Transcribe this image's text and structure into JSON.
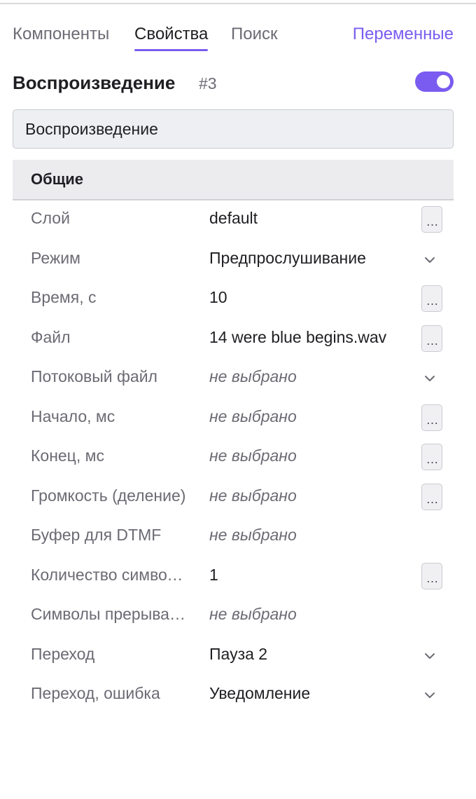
{
  "tabs": {
    "components": "Компоненты",
    "properties": "Свойства",
    "search": "Поиск",
    "variables": "Переменные"
  },
  "header": {
    "title": "Воспроизведение",
    "id": "#3",
    "enabled": true
  },
  "name_field": {
    "value": "Воспроизведение"
  },
  "section": {
    "title": "Общие"
  },
  "more_glyph": "…",
  "rows": [
    {
      "label": "Слой",
      "value": "default",
      "control": "more"
    },
    {
      "label": "Режим",
      "value": "Предпрослушивание",
      "control": "dropdown"
    },
    {
      "label": "Время, с",
      "value": "10",
      "control": "more"
    },
    {
      "label": "Файл",
      "value": "14 were blue begins.wav",
      "control": "more"
    },
    {
      "label": "Потоковый файл",
      "value": "не выбрано",
      "control": "dropdown",
      "empty": true
    },
    {
      "label": "Начало, мс",
      "value": "не выбрано",
      "control": "more",
      "empty": true
    },
    {
      "label": "Конец, мс",
      "value": "не выбрано",
      "control": "more",
      "empty": true
    },
    {
      "label": "Громкость (деление)",
      "value": "не выбрано",
      "control": "more",
      "empty": true
    },
    {
      "label": "Буфер для DTMF",
      "value": "не выбрано",
      "control": "none",
      "empty": true
    },
    {
      "label": "Количество символов",
      "value": "1",
      "control": "more"
    },
    {
      "label": "Символы прерывания",
      "value": "не выбрано",
      "control": "none",
      "empty": true
    },
    {
      "label": "Переход",
      "value": "Пауза 2",
      "control": "dropdown"
    },
    {
      "label": "Переход, ошибка",
      "value": "Уведомление",
      "control": "dropdown"
    }
  ],
  "colors": {
    "accent": "#7a5cf0",
    "muted_text": "#6b6b74",
    "section_bg": "#ececef"
  }
}
